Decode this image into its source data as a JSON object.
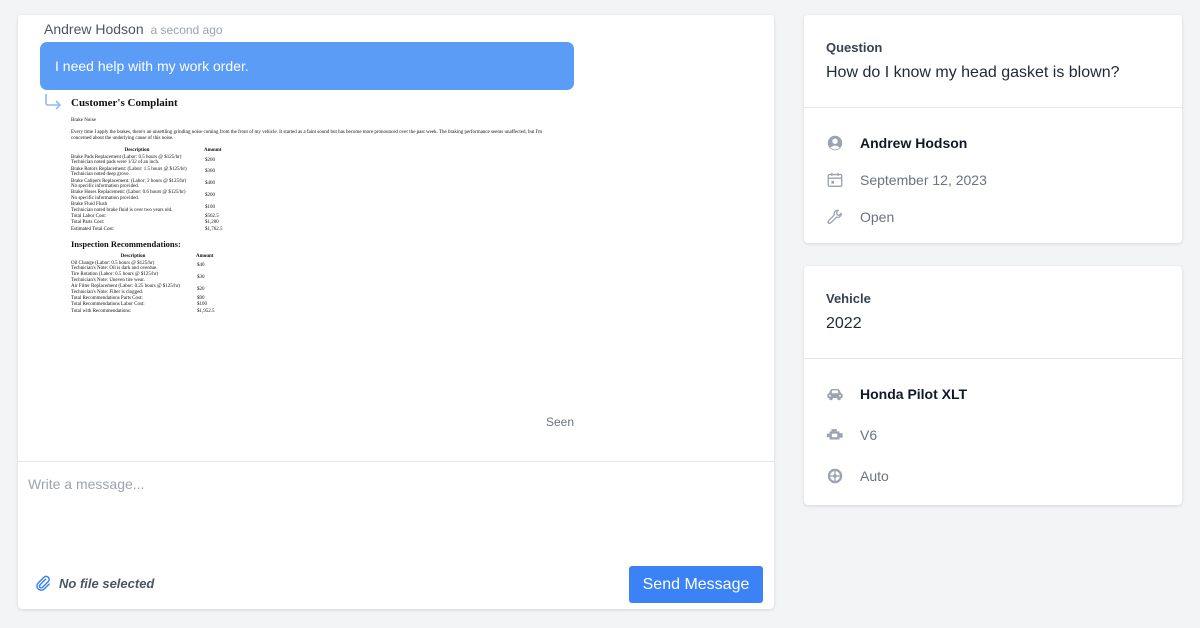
{
  "chat": {
    "sender": "Andrew Hodson",
    "time_ago": "a second ago",
    "message": "I need help with my work order.",
    "seen_label": "Seen"
  },
  "document": {
    "title": "Customer's Complaint",
    "subtitle": "Brake Noise",
    "paragraph": "Every time I apply the brakes, there's an unsettling grinding noise coming from the front of my vehicle. It started as a faint sound but has become more pronounced over the past week. The braking performance seems unaffected, but I'm concerned about the underlying cause of this noise.",
    "col_description": "Description",
    "col_amount": "Amount",
    "rows": [
      {
        "line1": "Brake Pads Replacement (Labor: 0.5 hours @ $125/hr)",
        "line2": "Technician noted pads were 1/32 of an inch.",
        "amount": "$200"
      },
      {
        "line1": "Brake Rotors Replacement: (Labor: 1.5 hours @ $125/hr)",
        "line2": "Technician noted deep grove.",
        "amount": "$300"
      },
      {
        "line1": "Brake Calipers Replacement: (Labor: 2 hours @ $125/hr)",
        "line2": "No specific information provided.",
        "amount": "$400"
      },
      {
        "line1": "Brake Hoses Replacement: (Labor: 0.6 hours @ $125/hr)",
        "line2": "No specific information provided.",
        "amount": "$200"
      },
      {
        "line1": "Brake Fluid Flush",
        "line2": "Technician noted brake fluid is over two years old.",
        "amount": "$100"
      },
      {
        "line1": "Total Labor Cost:",
        "line2": "",
        "amount": "$562.5"
      },
      {
        "line1": "Total Parts Cost:",
        "line2": "",
        "amount": "$1,200"
      },
      {
        "line1": "Estimated Total Cost:",
        "line2": "",
        "amount": "$1,762.5"
      }
    ],
    "inspection_title": "Inspection Recommendations:",
    "inspection_rows": [
      {
        "line1": "Oil Change (Labor: 0.5 hours @ $125/hr)",
        "line2": "Technician's Note: Oil is dark and overdue.",
        "amount": "$40"
      },
      {
        "line1": "Tire Rotation (Labor: 0.5 hours @ $125/hr)",
        "line2": "Technician's Note: Uneven tire wear.",
        "amount": "$30"
      },
      {
        "line1": "Air Filter Replacement (Labor: 0.25 hours @ $125/hr)",
        "line2": "Technician's Note: Filter is clogged.",
        "amount": "$20"
      },
      {
        "line1": "Total Recommendations Parts Cost:",
        "line2": "",
        "amount": "$90"
      },
      {
        "line1": "Total Recommendations Labor Cost:",
        "line2": "",
        "amount": "$100"
      },
      {
        "line1": "Total with Recommendations:",
        "line2": "",
        "amount": "$1,952.5"
      }
    ]
  },
  "compose": {
    "placeholder": "Write a message...",
    "file_status": "No file selected",
    "send_label": "Send Message"
  },
  "question_card": {
    "label": "Question",
    "question": "How do I know my head gasket is blown?",
    "customer": "Andrew Hodson",
    "date": "September 12, 2023",
    "status": "Open"
  },
  "vehicle_card": {
    "label": "Vehicle",
    "year": "2022",
    "model": "Honda Pilot XLT",
    "engine": "V6",
    "transmission": "Auto"
  },
  "icons": {
    "user": "user-circle-icon",
    "date": "calendar-icon",
    "status": "wrench-icon",
    "model": "car-icon",
    "engine": "engine-icon",
    "transmission": "gear-wheel-icon",
    "attach": "paperclip-icon",
    "reply": "reply-arrow-icon"
  },
  "colors": {
    "bubble": "#5b9cf6",
    "send_button": "#3b82f6",
    "background": "#f3f4f6",
    "icon_gray": "#9ca3af"
  }
}
